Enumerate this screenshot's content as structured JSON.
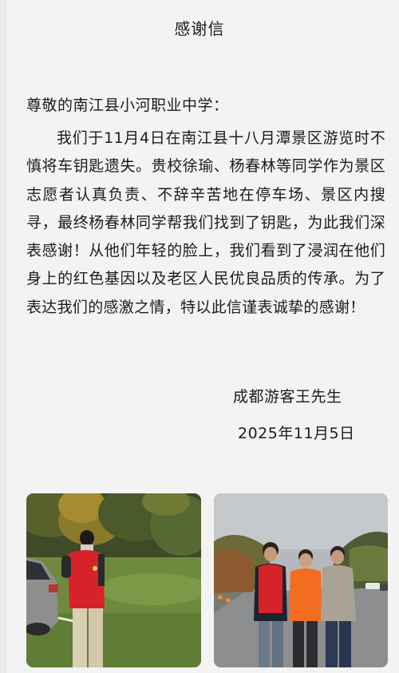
{
  "letter": {
    "title": "感谢信",
    "salutation": "尊敬的南江县小河职业中学：",
    "body": "我们于11月4日在南江县十八月潭景区游览时不慎将车钥匙遗失。贵校徐瑜、杨春林等同学作为景区志愿者认真负责、不辞辛苦地在停车场、景区内搜寻，最终杨春林同学帮我们找到了钥匙，为此我们深表感谢！从他们年轻的脸上，我们看到了浸润在他们身上的红色基因以及老区人民优良品质的传承。为了表达我们的感激之情，特以此信谨表诚挚的感谢！",
    "signature": "成都游客王先生",
    "date": "2025年11月5日"
  },
  "photos": [
    {
      "subject": "volunteer-photographing-parking-lot"
    },
    {
      "subject": "student-with-two-visitors"
    }
  ],
  "colors": {
    "background": "#f3f3f4",
    "text": "#1c1c1c",
    "vest_red": "#d8222a"
  }
}
